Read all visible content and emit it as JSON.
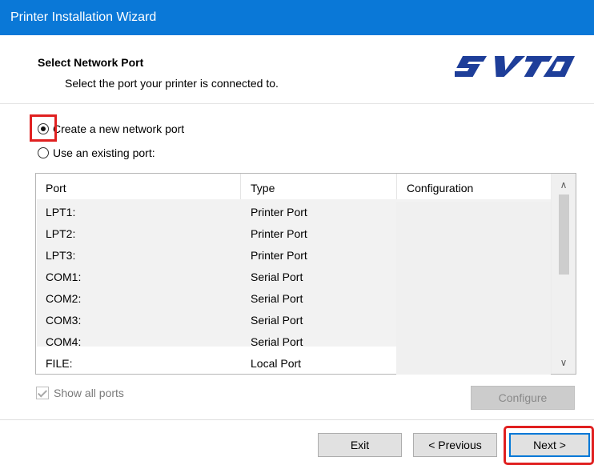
{
  "window": {
    "title": "Printer Installation Wizard"
  },
  "header": {
    "title": "Select Network Port",
    "subtitle": "Select the port your printer is connected to.",
    "logo_text": "SATO"
  },
  "options": {
    "create_new": "Create a new network port",
    "use_existing": "Use an existing port:",
    "selected": "create_new"
  },
  "port_list": {
    "columns": [
      "Port",
      "Type",
      "Configuration"
    ],
    "rows": [
      {
        "port": "LPT1:",
        "type": "Printer Port",
        "config": ""
      },
      {
        "port": "LPT2:",
        "type": "Printer Port",
        "config": ""
      },
      {
        "port": "LPT3:",
        "type": "Printer Port",
        "config": ""
      },
      {
        "port": "COM1:",
        "type": "Serial Port",
        "config": ""
      },
      {
        "port": "COM2:",
        "type": "Serial Port",
        "config": ""
      },
      {
        "port": "COM3:",
        "type": "Serial Port",
        "config": ""
      },
      {
        "port": "COM4:",
        "type": "Serial Port",
        "config": ""
      },
      {
        "port": "FILE:",
        "type": "Local Port",
        "config": ""
      }
    ]
  },
  "show_all_ports": {
    "label": "Show all ports",
    "checked": true,
    "enabled": false
  },
  "buttons": {
    "configure": "Configure",
    "exit": "Exit",
    "previous": "< Previous",
    "next": "Next >"
  },
  "colors": {
    "titlebar": "#0a78d7",
    "logo": "#1e3e99",
    "highlight": "#e02020"
  }
}
